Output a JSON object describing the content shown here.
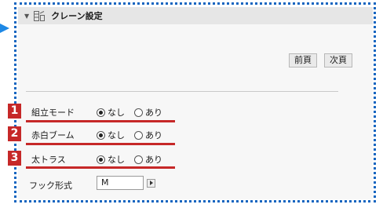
{
  "header": {
    "title": "クレーン設定",
    "collapse_icon": "triangle-down-icon",
    "section_icon": "crane-settings-icon"
  },
  "buttons": {
    "prev": "前頁",
    "next": "次頁"
  },
  "rows": [
    {
      "marker": "1",
      "label": "組立モード",
      "options": [
        "なし",
        "あり"
      ],
      "selected": "なし"
    },
    {
      "marker": "2",
      "label": "赤白ブーム",
      "options": [
        "なし",
        "あり"
      ],
      "selected": "なし"
    },
    {
      "marker": "3",
      "label": "太トラス",
      "options": [
        "なし",
        "あり"
      ],
      "selected": "なし"
    }
  ],
  "hook": {
    "label": "フック形式",
    "value": "M"
  },
  "colors": {
    "frame": "#1565c0",
    "marker": "#c62828",
    "underline": "#c62828"
  }
}
